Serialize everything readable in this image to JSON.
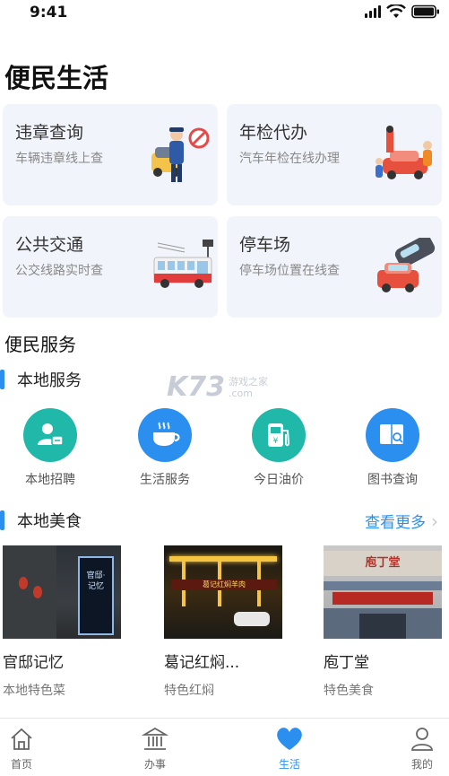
{
  "status": {
    "time": "9:41"
  },
  "page": {
    "title": "便民生活"
  },
  "cards": [
    {
      "title": "违章查询",
      "sub": "车辆违章线上查",
      "art": "traffic-police-icon"
    },
    {
      "title": "年检代办",
      "sub": "汽车年检在线办理",
      "art": "car-inspection-icon"
    },
    {
      "title": "公共交通",
      "sub": "公交线路实时查",
      "art": "bus-icon"
    },
    {
      "title": "停车场",
      "sub": "停车场位置在线查",
      "art": "parking-icon"
    }
  ],
  "section": {
    "title": "便民服务"
  },
  "local_service": {
    "title": "本地服务",
    "items": [
      {
        "label": "本地招聘",
        "icon": "recruit-icon",
        "color": "#1fb8a9"
      },
      {
        "label": "生活服务",
        "icon": "coffee-icon",
        "color": "#2b8ff0"
      },
      {
        "label": "今日油价",
        "icon": "fuel-icon",
        "color": "#1fb8a9"
      },
      {
        "label": "图书查询",
        "icon": "book-search-icon",
        "color": "#2b8ff0"
      }
    ]
  },
  "local_food": {
    "title": "本地美食",
    "more": "查看更多",
    "items": [
      {
        "name": "官邸记忆",
        "tag": "本地特色菜",
        "sign": "官邸·记忆"
      },
      {
        "name": "葛记红焖...",
        "tag": "特色红焖",
        "sign": "葛记红焖羊肉"
      },
      {
        "name": "庖丁堂",
        "tag": "特色美食",
        "sign": "庖丁堂"
      }
    ]
  },
  "tabs": [
    {
      "label": "首页",
      "icon": "home-icon"
    },
    {
      "label": "办事",
      "icon": "bank-icon"
    },
    {
      "label": "生活",
      "icon": "heart-icon"
    },
    {
      "label": "我的",
      "icon": "user-icon"
    }
  ],
  "watermark": {
    "big": "K73",
    "small1": "游戏之家",
    "small2": ".com"
  },
  "colors": {
    "accent": "#2b8ff0",
    "teal": "#1fb8a9",
    "card_bg": "#f1f5fb"
  }
}
